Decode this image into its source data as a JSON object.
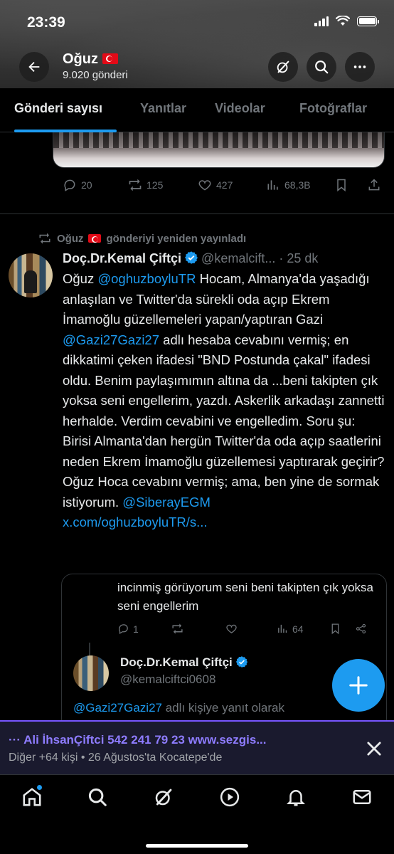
{
  "status": {
    "time": "23:39"
  },
  "profile": {
    "name": "Oğuz",
    "post_count": "9.020 gönderi"
  },
  "tabs": [
    {
      "label": "Gönderi sayısı",
      "active": true
    },
    {
      "label": "Yanıtlar"
    },
    {
      "label": "Videolar"
    },
    {
      "label": "Fotoğraflar"
    }
  ],
  "prev_post": {
    "replies": "20",
    "reposts": "125",
    "likes": "427",
    "views": "68,3B"
  },
  "tweet": {
    "repost_by": "Oğuz",
    "repost_suffix": "gönderiyi yeniden yayınladı",
    "author_name": "Doç.Dr.Kemal Çiftçi",
    "handle": "@kemalcift...",
    "time": "· 25 dk",
    "text_parts": {
      "p1": "Oğuz ",
      "m1": "@oghuzboyluTR",
      "p2": " Hocam, Almanya'da yaşadığı anlaşılan ve Twitter'da sürekli oda açıp Ekrem İmamoğlu güzellemeleri yapan/yaptıran Gazi ",
      "m2": "@Gazi27Gazi27",
      "p3": " adlı hesaba cevabını vermiş; en dikkatimi çeken ifadesi \"BND Postunda çakal\" ifadesi oldu. Benim paylaşımımın altına da ...beni takipten çık yoksa seni engellerim, yazdı. Askerlik arkadaşı zannetti herhalde. Verdim cevabini ve engelledim. Soru şu: Birisi Almanta'dan hergün Twitter'da oda açıp saatlerini neden Ekrem İmamoğlu güzellemesi yaptırarak geçirir? Oğuz Hoca cevabını vermiş; ama, ben yine de sormak istiyorum. ",
      "m3": "@SiberayEGM",
      "link": "x.com/oghuzboyluTR/s..."
    }
  },
  "quote": {
    "text": "incinmiş görüyorum seni beni takipten çık yoksa seni engellerim",
    "replies": "1",
    "views": "64",
    "author_name": "Doç.Dr.Kemal Çiftçi",
    "handle": "@kemalciftci0608",
    "reply_to_handle": "@Gazi27Gazi27",
    "reply_to_suffix": " adlı kişiye yanıt olarak"
  },
  "spaces": {
    "title": "··· Ali İhsanÇiftci 542 241 79 23 www.sezgis...",
    "subtitle": "Diğer +64 kişi • 26 Ağustos'ta Kocatepe'de"
  },
  "colors": {
    "accent": "#1d9bf0",
    "spaces_purple": "#7856ff",
    "muted": "#71767b",
    "text": "#e7e9ea"
  },
  "icons": {
    "back": "arrow-left-icon",
    "grok": "grok-icon",
    "search": "search-icon",
    "more": "more-icon",
    "repost": "repost-icon",
    "verified": "verified-badge-icon"
  }
}
